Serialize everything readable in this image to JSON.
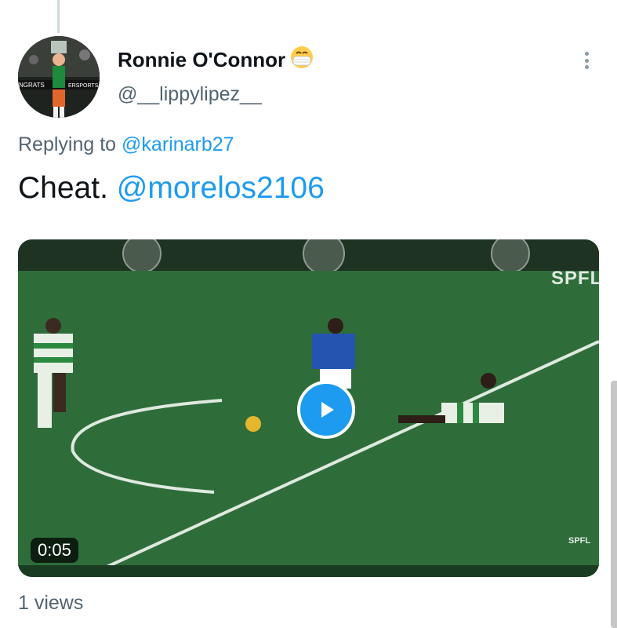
{
  "tweet": {
    "author_name": "Ronnie O'Connor",
    "author_emoji": "😷",
    "author_handle": "@__lippylipez__",
    "avatar_text_left": "NGRATS",
    "avatar_text_right": "ERSPORTS",
    "replying_prefix": "Replying to",
    "replying_to": "@karinarb27",
    "text_main": "Cheat.",
    "text_mention": "@morelos2106",
    "views": "1 views"
  },
  "video": {
    "duration": "0:05",
    "watermark": "SPFL",
    "watermark_small": "SPFL"
  },
  "colors": {
    "link": "#1d9bf0",
    "secondary_text": "#536471",
    "pitch": "#2f6a3b"
  }
}
